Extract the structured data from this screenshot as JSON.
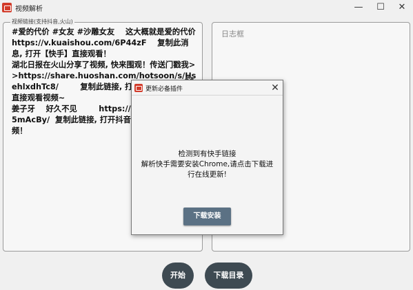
{
  "window": {
    "title": "视频解析",
    "min_glyph": "—",
    "max_glyph": "☐",
    "close_glyph": "✕"
  },
  "link_panel": {
    "legend": "视频链接(支持抖音,火山)",
    "text": "#爱的代价 #女友 #沙雕女友    这大概就是爱的代价    https://v.kuaishou.com/6P44zF    复制此消息, 打开【快手】直接观看！\n湖北日报在火山分享了视频, 快来围观！传送门戳我>>https://share.huoshan.com/hotsoon/s/HsehlxdhTc8/        复制此链接, 打开【抖音火山版】, 直接观看视频~\n姜子牙    好久不见        https://v.douyin.com/J5mAcBy/  复制此链接, 打开抖音搜索, 直接观看视频！",
    "clear_icon": "clear-icon",
    "clear_glyph": "✕"
  },
  "log_panel": {
    "label": "日志框"
  },
  "buttons": {
    "start": "开始",
    "download_dir": "下载目录"
  },
  "dialog": {
    "title": "更新必备插件",
    "close_glyph": "✕",
    "message": "检测到有快手链接\n解析快手需要安装Chrome,请点击下载进行在线更新!",
    "install_button": "下载安装"
  },
  "colors": {
    "accent_dark": "#3e4a52",
    "install_button": "#5b7184",
    "app_icon": "#d23b2a"
  }
}
